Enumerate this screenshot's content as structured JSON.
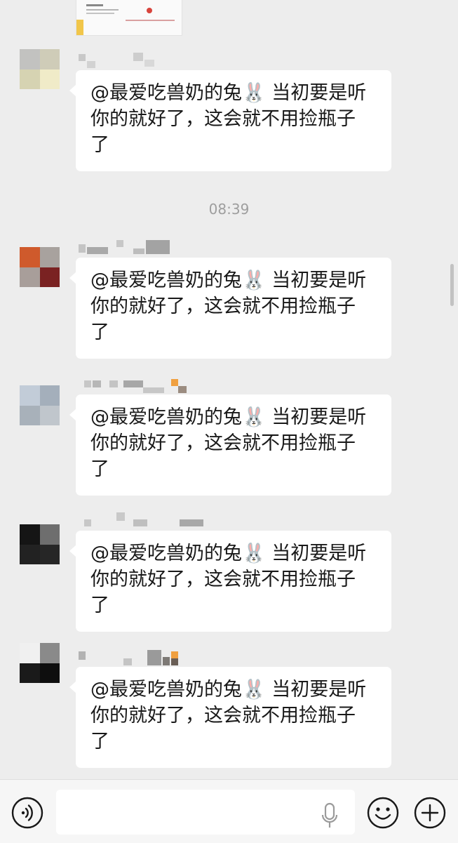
{
  "messages": [
    {
      "text_line1": "@最爱吃兽奶的兔🐰 当初要是听",
      "text_line2": "你的就好了，这会就不用捡瓶子",
      "text_line3": "了"
    },
    {
      "text_line1": "@最爱吃兽奶的兔🐰 当初要是听",
      "text_line2": "你的就好了，这会就不用捡瓶子",
      "text_line3": "了"
    },
    {
      "text_line1": "@最爱吃兽奶的兔🐰 当初要是听",
      "text_line2": "你的就好了，这会就不用捡瓶子",
      "text_line3": "了"
    },
    {
      "text_line1": "@最爱吃兽奶的兔🐰 当初要是听",
      "text_line2": "你的就好了，这会就不用捡瓶子",
      "text_line3": "了"
    },
    {
      "text_line1": "@最爱吃兽奶的兔🐰 当初要是听",
      "text_line2": "你的就好了，这会就不用捡瓶子",
      "text_line3": "了"
    }
  ],
  "timestamp": "08:39",
  "input": {
    "placeholder": ""
  },
  "icons": {
    "voice": "voice-mode-icon",
    "mic": "microphone-icon",
    "emoji": "emoji-icon",
    "plus": "plus-icon"
  },
  "colors": {
    "background": "#ededed",
    "bubble": "#ffffff",
    "text": "#191919",
    "timestamp": "#9e9e9e"
  }
}
